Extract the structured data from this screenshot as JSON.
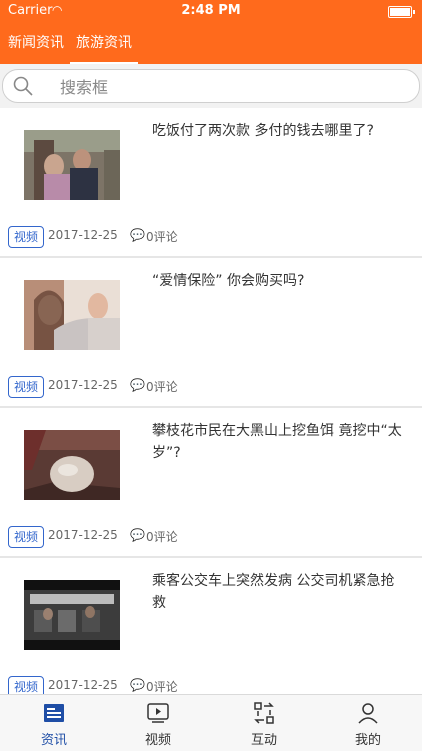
{
  "status": {
    "carrier": "Carrier",
    "time": "2:48 PM"
  },
  "top_tabs": [
    {
      "label": "新闻资讯"
    },
    {
      "label": "旅游资讯"
    }
  ],
  "search": {
    "placeholder": "搜索框"
  },
  "items": [
    {
      "title": "吃饭付了两次款 多付的钱去哪里了?",
      "tag": "视频",
      "date": "2017-12-25",
      "comments": "0评论"
    },
    {
      "title": "“爱情保险” 你会购买吗?",
      "tag": "视频",
      "date": "2017-12-25",
      "comments": "0评论"
    },
    {
      "title": "攀枝花市民在大黑山上挖鱼饵 竟挖中“太岁”?",
      "tag": "视频",
      "date": "2017-12-25",
      "comments": "0评论"
    },
    {
      "title": "乘客公交车上突然发病 公交司机紧急抢救",
      "tag": "视频",
      "date": "2017-12-25",
      "comments": "0评论"
    }
  ],
  "tabbar": [
    {
      "label": "资讯"
    },
    {
      "label": "视频"
    },
    {
      "label": "互动"
    },
    {
      "label": "我的"
    }
  ],
  "colors": {
    "accent": "#ff6a1c",
    "tag": "#3366cc",
    "active_tab": "#1f4ea6"
  }
}
